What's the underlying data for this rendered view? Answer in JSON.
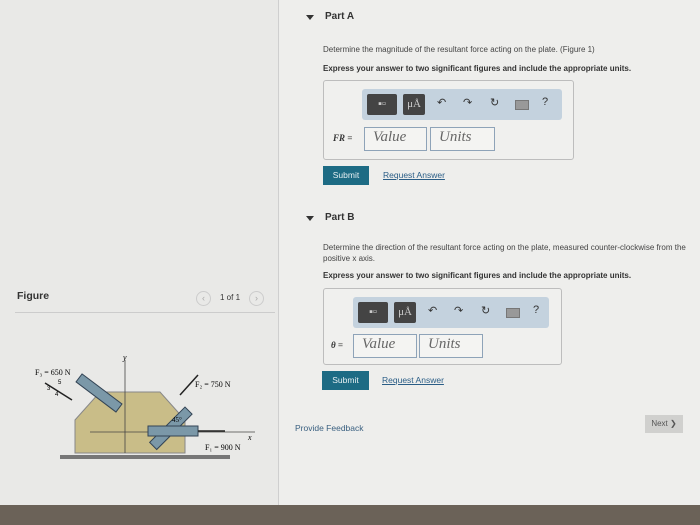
{
  "figure_panel": {
    "title": "Figure",
    "pager": "1 of 1",
    "labels": {
      "f3": "F₃ = 650 N",
      "f2": "F₂ = 750 N",
      "f1": "F₁ = 900 N",
      "angle": "45°",
      "x_axis": "x",
      "y_axis": "y",
      "slope_5": "5",
      "slope_3": "3",
      "slope_4": "4"
    }
  },
  "part_a": {
    "title": "Part A",
    "question": "Determine the magnitude of the resultant force acting on the plate.",
    "figure_link": "(Figure 1)",
    "instruction": "Express your answer to two significant figures and include the appropriate units.",
    "var_label": "FR =",
    "value_placeholder": "Value",
    "units_placeholder": "Units",
    "submit": "Submit",
    "request": "Request Answer"
  },
  "part_b": {
    "title": "Part B",
    "question": "Determine the direction of the resultant force acting on the plate, measured counter-clockwise from the positive x axis.",
    "instruction": "Express your answer to two significant figures and include the appropriate units.",
    "var_label": "θ =",
    "value_placeholder": "Value",
    "units_placeholder": "Units",
    "submit": "Submit",
    "request": "Request Answer"
  },
  "toolbar": {
    "units_symbol": "μÅ",
    "help": "?"
  },
  "footer": {
    "feedback": "Provide Feedback",
    "next": "Next ❯"
  },
  "colors": {
    "submit": "#1d6b84",
    "link": "#2a5d86",
    "toolbar": "#c4d2de"
  }
}
